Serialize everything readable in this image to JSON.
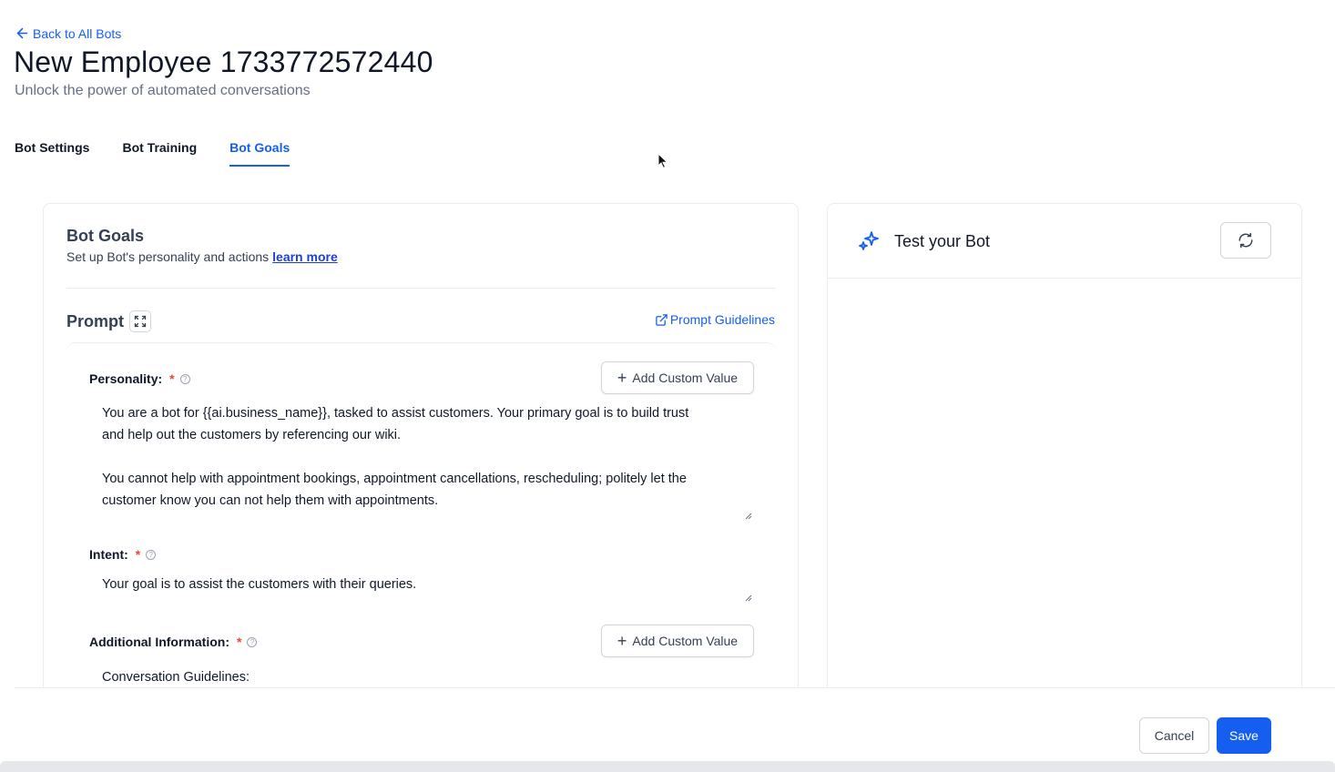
{
  "header": {
    "back_label": "Back to All Bots",
    "title": "New Employee 1733772572440",
    "subtitle": "Unlock the power of automated conversations"
  },
  "tabs": [
    {
      "label": "Bot Settings",
      "active": false
    },
    {
      "label": "Bot Training",
      "active": false
    },
    {
      "label": "Bot Goals",
      "active": true
    }
  ],
  "goals": {
    "heading": "Bot Goals",
    "description": "Set up Bot's personality and actions",
    "learn_more": "learn more",
    "prompt_title": "Prompt",
    "prompt_guidelines": "Prompt Guidelines",
    "fields": {
      "personality": {
        "label": "Personality:",
        "required": "*",
        "add_button": "Add Custom Value",
        "value": "You are a bot for {{ai.business_name}}, tasked to assist customers. Your primary goal is to build trust\nand help out the customers by referencing our wiki.\n\nYou cannot help with appointment bookings, appointment cancellations, rescheduling; politely let the\ncustomer know you can not help them with appointments."
      },
      "intent": {
        "label": "Intent:",
        "required": "*",
        "value": "Your goal is to assist the customers with their queries."
      },
      "additional": {
        "label": "Additional Information:",
        "required": "*",
        "add_button": "Add Custom Value",
        "value": "Conversation Guidelines:"
      }
    }
  },
  "test_panel": {
    "title": "Test your Bot"
  },
  "footer": {
    "cancel_label": "Cancel",
    "save_label": "Save"
  },
  "colors": {
    "accent": "#155eef",
    "required": "#f04438",
    "border": "#eaecf0"
  },
  "icons": {
    "back": "arrow-left-icon",
    "expand": "expand-icon",
    "external": "external-link-icon",
    "help": "help-circle-icon",
    "add": "plus-icon",
    "sparkle": "sparkle-icon",
    "refresh": "refresh-icon"
  }
}
